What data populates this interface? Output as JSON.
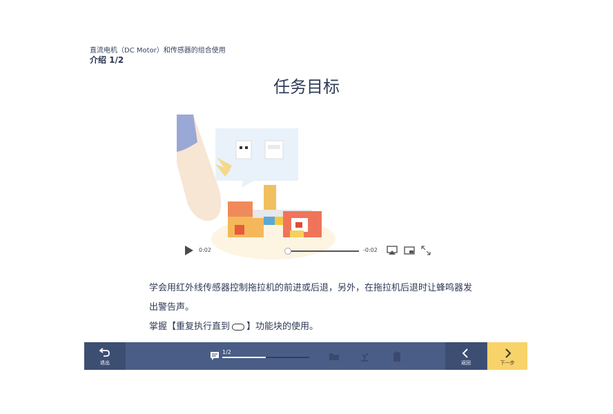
{
  "header": {
    "subtitle": "直流电机（DC Motor）和传感器的组合使用",
    "section": "介绍 1/2"
  },
  "page_title": "任务目标",
  "video": {
    "current_time": "0:02",
    "remaining_time": "-0:02",
    "progress": 0.02
  },
  "description": {
    "line1": "学会用红外线传感器控制拖拉机的前进或后退，另外，在拖拉机后退时让蜂鸣器发出警告声。",
    "line2_before": "掌握【重复执行直到",
    "line2_after": "】功能块的使用。"
  },
  "bottom_bar": {
    "exit_label": "退出",
    "progress_label": "1/2",
    "progress_fraction": 0.5,
    "prev_label": "返回",
    "next_label": "下一步"
  },
  "colors": {
    "bar": "#4a5d86",
    "bar_dark": "#3d4e73",
    "next_button": "#f7d36a",
    "title": "#2f3b58"
  }
}
